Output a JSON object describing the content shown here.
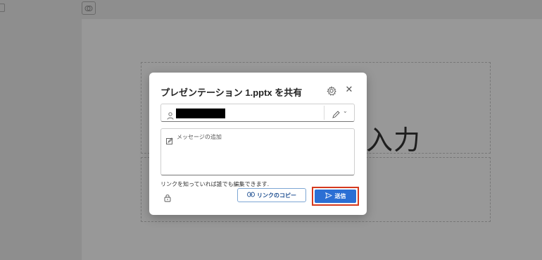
{
  "dialog": {
    "title": "プレゼンテーション 1.pptx を共有",
    "recipient_value": "",
    "message_placeholder": "メッセージの追加",
    "access_note": "リンクを知っていれば誰でも編集できます.",
    "copy_link_label": "リンクのコピー",
    "send_label": "送信"
  },
  "slide": {
    "visible_title_text": "入力"
  },
  "colors": {
    "accent": "#2b6fd4",
    "highlight": "#d53a1f"
  },
  "icons": [
    "gear-icon",
    "close-icon",
    "person-icon",
    "pencil-icon",
    "chevron-down-icon",
    "message-icon",
    "lock-icon",
    "link-icon",
    "send-icon"
  ]
}
